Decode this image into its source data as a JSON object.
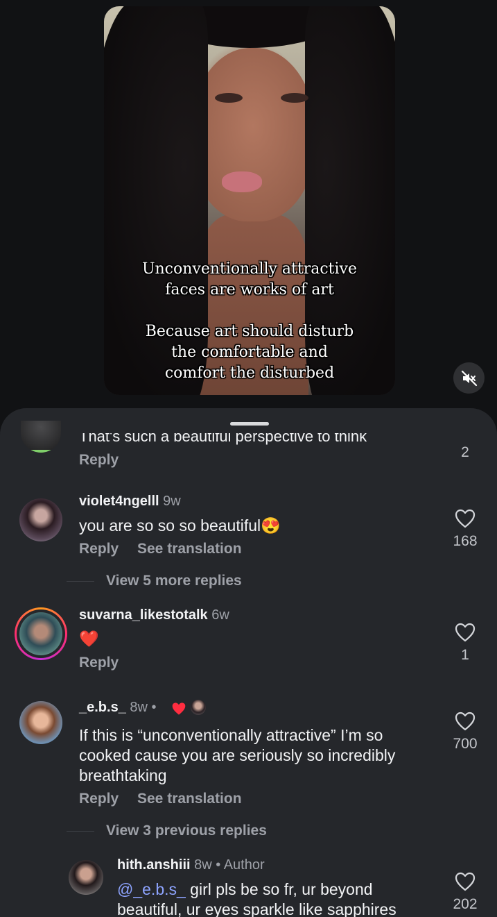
{
  "video": {
    "caption_line1": "Unconventionally attractive",
    "caption_line2": "faces are works of art",
    "caption_line3": "Because art should disturb",
    "caption_line4": "the comfortable and",
    "caption_line5": "comfort the disturbed",
    "mute_icon": "speaker-muted-icon"
  },
  "comments": {
    "partial": {
      "text": "That's such a beautiful perspective to think",
      "reply_label": "Reply",
      "like_count": "2"
    },
    "c1": {
      "username": "violet4ngelll",
      "time": "9w",
      "text": "you are so so so beautiful",
      "emoji": "😍",
      "reply_label": "Reply",
      "translate_label": "See translation",
      "like_count": "168",
      "view_replies": "View 5 more replies"
    },
    "c2": {
      "username": "suvarna_likestotalk",
      "time": "6w",
      "text": "❤️",
      "reply_label": "Reply",
      "like_count": "1"
    },
    "c3": {
      "username": "_e.b.s_",
      "time": "8w",
      "sep": "•",
      "text": "If this is “unconventionally attractive” I’m so cooked cause you are seriously so incredibly breathtaking",
      "reply_label": "Reply",
      "translate_label": "See translation",
      "like_count": "700",
      "view_replies": "View 3 previous replies"
    },
    "c4": {
      "username": "hith.anshiii",
      "time": "8w",
      "author_label": "• Author",
      "mention": "@_e.b.s_",
      "text": " girl pls be so fr, ur beyond beautiful, ur eyes sparkle like sapphires",
      "like_count": "202"
    }
  },
  "colors": {
    "sheet": "#25272b",
    "muted_text": "#9ea1a8",
    "heart_red": "#ff2d40",
    "mention": "#8ea4ff"
  }
}
